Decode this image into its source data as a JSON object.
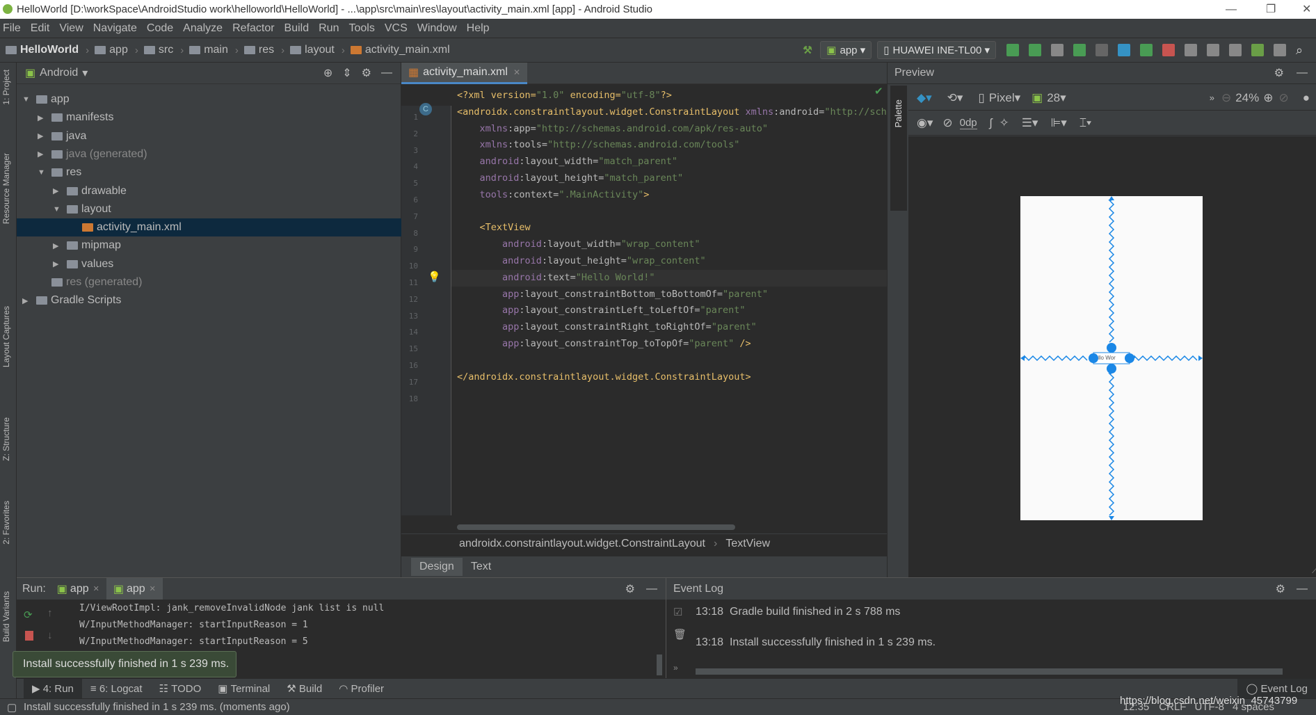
{
  "window": {
    "title": "HelloWorld [D:\\workSpace\\AndroidStudio work\\helloworld\\HelloWorld] - ...\\app\\src\\main\\res\\layout\\activity_main.xml [app] - Android Studio"
  },
  "menu": [
    "File",
    "Edit",
    "View",
    "Navigate",
    "Code",
    "Analyze",
    "Refactor",
    "Build",
    "Run",
    "Tools",
    "VCS",
    "Window",
    "Help"
  ],
  "breadcrumbs": [
    "HelloWorld",
    "app",
    "src",
    "main",
    "res",
    "layout",
    "activity_main.xml"
  ],
  "toolbar": {
    "config": "app",
    "device": "HUAWEI INE-TL00"
  },
  "left_strip": [
    "1: Project",
    "Resource Manager",
    "Layout Captures",
    "Z: Structure",
    "2: Favorites",
    "Build Variants"
  ],
  "project": {
    "view": "Android",
    "tree": [
      {
        "label": "app",
        "depth": 0,
        "open": true
      },
      {
        "label": "manifests",
        "depth": 1
      },
      {
        "label": "java",
        "depth": 1
      },
      {
        "label": "java (generated)",
        "depth": 1,
        "gray": true
      },
      {
        "label": "res",
        "depth": 1,
        "open": true
      },
      {
        "label": "drawable",
        "depth": 2
      },
      {
        "label": "layout",
        "depth": 2,
        "open": true
      },
      {
        "label": "activity_main.xml",
        "depth": 3,
        "selected": true,
        "leaf": true
      },
      {
        "label": "mipmap",
        "depth": 2
      },
      {
        "label": "values",
        "depth": 2
      },
      {
        "label": "res (generated)",
        "depth": 1,
        "gray": true,
        "leaf": true
      },
      {
        "label": "Gradle Scripts",
        "depth": 0
      }
    ]
  },
  "editor": {
    "tab": "activity_main.xml",
    "current_line": 12,
    "lines": [
      [
        "<?xml version=\"1.0\" encoding=\"utf-8\"?>"
      ],
      [
        "<androidx.constraintlayout.widget.ConstraintLayout xmlns:android=\"http://schemas.android.com/apk/res/android\""
      ],
      [
        "    xmlns:app=\"http://schemas.android.com/apk/res-auto\""
      ],
      [
        "    xmlns:tools=\"http://schemas.android.com/tools\""
      ],
      [
        "    android:layout_width=\"match_parent\""
      ],
      [
        "    android:layout_height=\"match_parent\""
      ],
      [
        "    tools:context=\".MainActivity\">"
      ],
      [
        ""
      ],
      [
        "    <TextView"
      ],
      [
        "        android:layout_width=\"wrap_content\""
      ],
      [
        "        android:layout_height=\"wrap_content\""
      ],
      [
        "        android:text=\"Hello World!\""
      ],
      [
        "        app:layout_constraintBottom_toBottomOf=\"parent\""
      ],
      [
        "        app:layout_constraintLeft_toLeftOf=\"parent\""
      ],
      [
        "        app:layout_constraintRight_toRightOf=\"parent\""
      ],
      [
        "        app:layout_constraintTop_toTopOf=\"parent\" />"
      ],
      [
        ""
      ],
      [
        "</androidx.constraintlayout.widget.ConstraintLayout>"
      ]
    ],
    "path": [
      "androidx.constraintlayout.widget.ConstraintLayout",
      "TextView"
    ],
    "mode_tabs": [
      "Design",
      "Text"
    ],
    "active_mode": "Text"
  },
  "preview": {
    "title": "Preview",
    "palette": "Palette",
    "device": "Pixel",
    "api": "28",
    "zoom": "24%",
    "margin": "0dp",
    "textview_text": "llo Wor"
  },
  "run": {
    "label": "Run:",
    "tabs": [
      "app",
      "app"
    ],
    "log": [
      "I/ViewRootImpl: jank_removeInvalidNode jank list is null",
      "W/InputMethodManager: startInputReason = 1",
      "W/InputMethodManager: startInputReason = 5"
    ]
  },
  "event_log": {
    "title": "Event Log",
    "entries": [
      {
        "time": "13:18",
        "text": "Gradle build finished in 2 s 788 ms"
      },
      {
        "time": "13:18",
        "text": "Install successfully finished in 1 s 239 ms."
      }
    ]
  },
  "balloon": "Install successfully finished in 1 s 239 ms.",
  "tool_windows": [
    "4: Run",
    "6: Logcat",
    "TODO",
    "Terminal",
    "Build",
    "Profiler"
  ],
  "event_log_button": "Event Log",
  "status": {
    "message": "Install successfully finished in 1 s 239 ms. (moments ago)",
    "time": "12:35",
    "line_sep": "CRLF",
    "encoding": "UTF-8",
    "indent": "4 spaces",
    "watermark": "https://blog.csdn.net/weixin_45743799"
  }
}
